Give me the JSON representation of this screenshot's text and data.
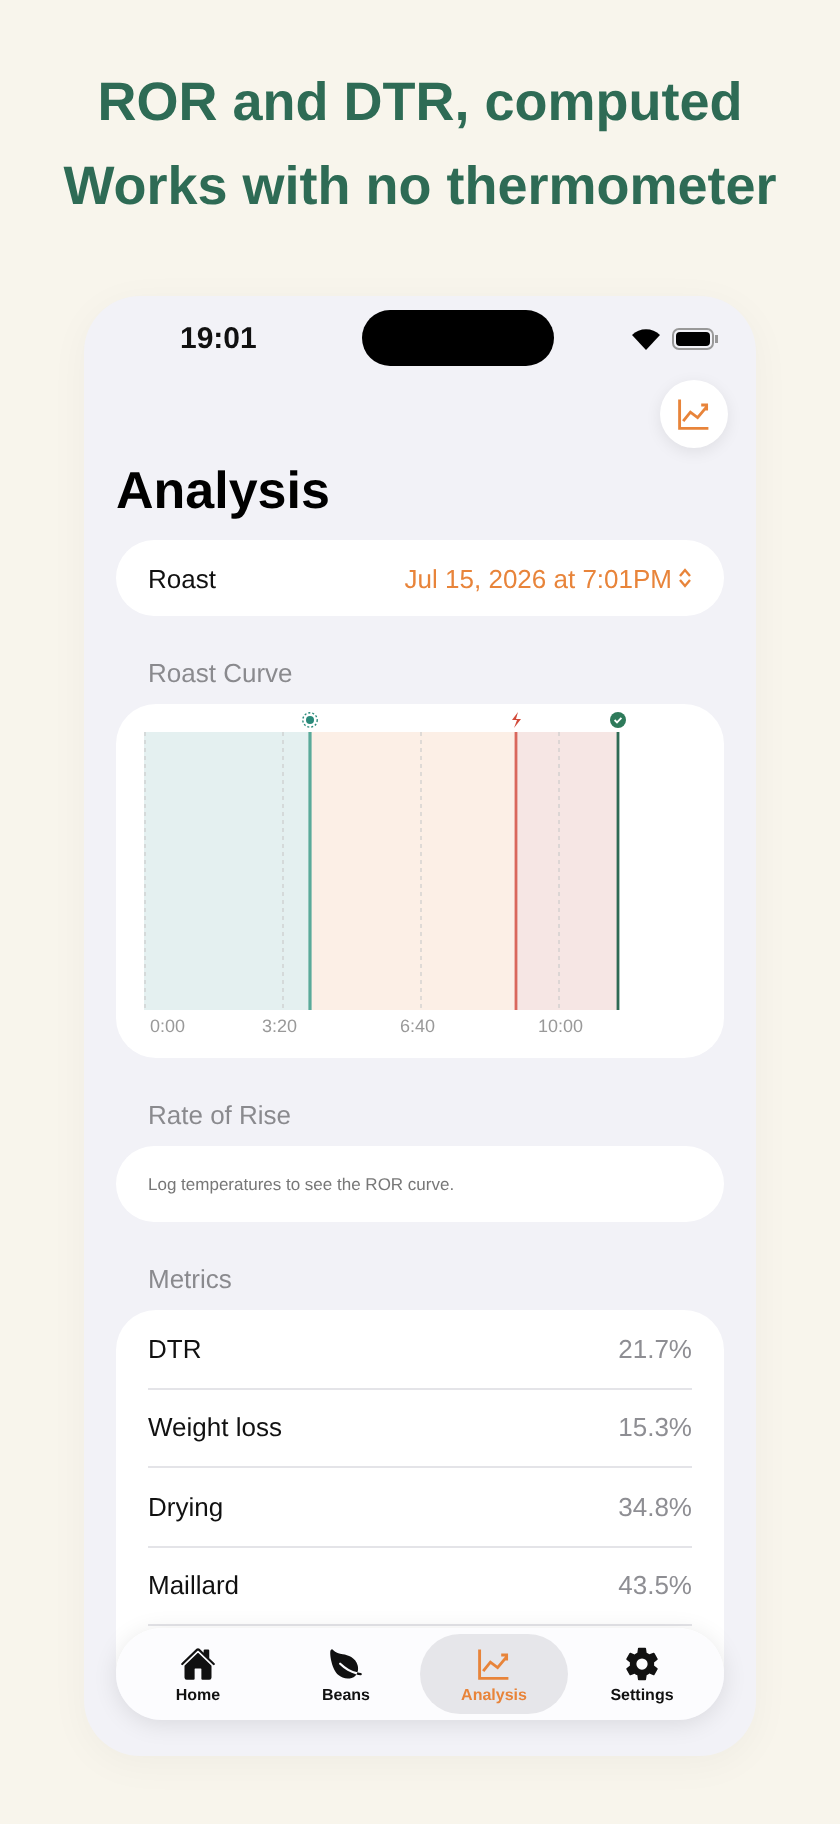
{
  "headline": [
    "ROR and DTR, computed",
    "Works with no thermometer"
  ],
  "status_bar": {
    "time": "19:01"
  },
  "title": "Analysis",
  "roast_picker": {
    "label": "Roast",
    "value": "Jul 15, 2026 at 7:01PM"
  },
  "roast_curve": {
    "heading": "Roast Curve",
    "ticks": [
      "0:00",
      "3:20",
      "6:40",
      "10:00"
    ]
  },
  "rate_of_rise": {
    "heading": "Rate of Rise",
    "message": "Log temperatures to see the ROR curve."
  },
  "metrics": {
    "heading": "Metrics",
    "rows": [
      {
        "label": "DTR",
        "value": "21.7%"
      },
      {
        "label": "Weight loss",
        "value": "15.3%"
      },
      {
        "label": "Drying",
        "value": "34.8%"
      },
      {
        "label": "Maillard",
        "value": "43.5%"
      }
    ]
  },
  "tab_bar": [
    {
      "label": "Home",
      "kind": "home",
      "selected": false
    },
    {
      "label": "Beans",
      "kind": "beans",
      "selected": false
    },
    {
      "label": "Analysis",
      "kind": "analysis",
      "selected": true
    },
    {
      "label": "Settings",
      "kind": "settings",
      "selected": false
    }
  ]
}
